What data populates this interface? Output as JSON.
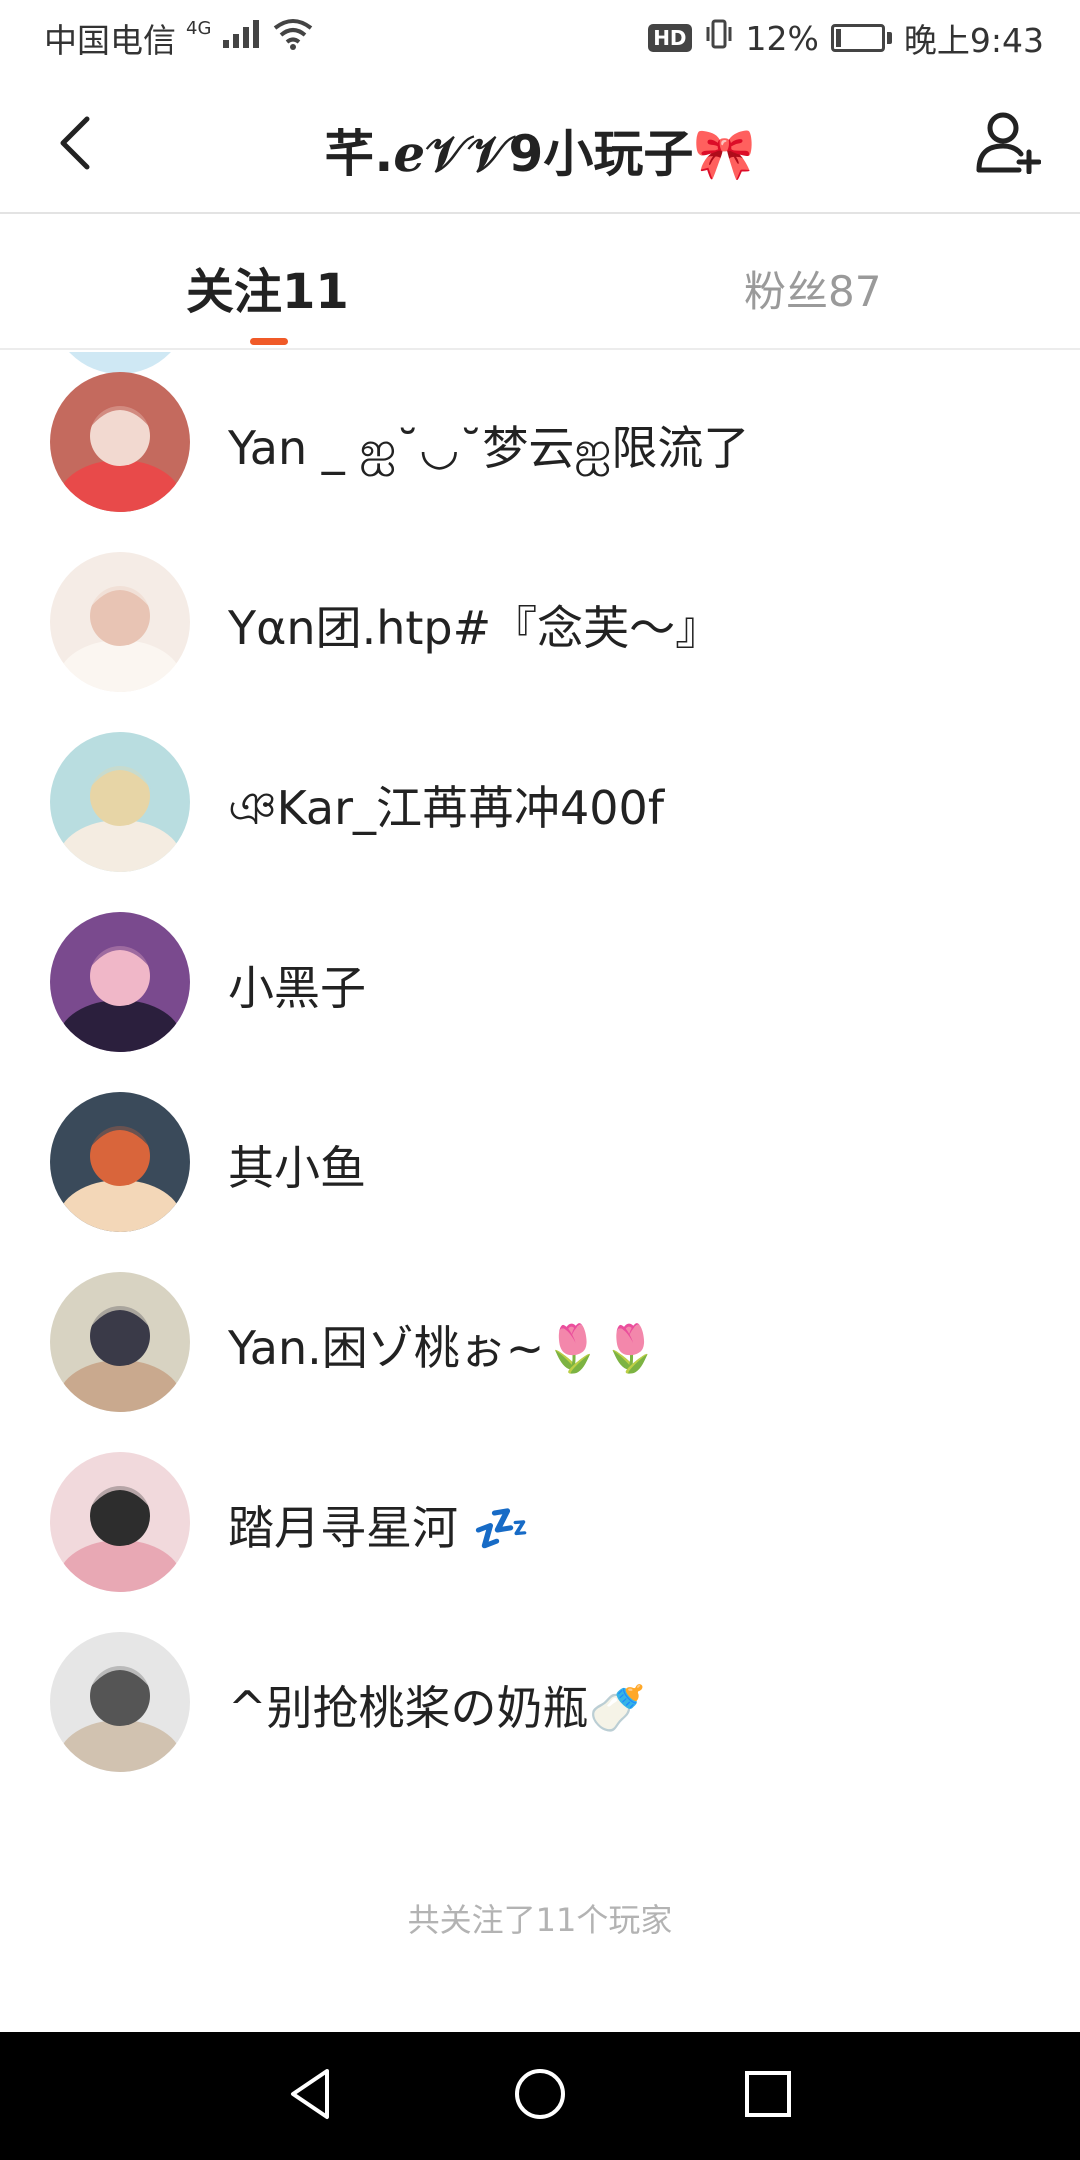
{
  "status_bar": {
    "carrier": "中国电信",
    "network": "4G",
    "hd_badge": "HD",
    "battery": "12%",
    "battery_level": 0.12,
    "time": "晚上9:43"
  },
  "header": {
    "title": "芊.ℯ𝒱𝒱9小玩子🎀",
    "back_icon": "chevron-left-icon",
    "follow_icon": "add-user-icon"
  },
  "tabs": [
    {
      "label": "关注11",
      "active": true
    },
    {
      "label": "粉丝87",
      "active": false
    }
  ],
  "colors": {
    "accent": "#f05a28",
    "text": "#222222",
    "muted": "#9a9a9a"
  },
  "following": [
    {
      "name": "Yan _ ஐ˘◡˘梦云ஐ限流了",
      "avatar_colors": [
        "#c46a5e",
        "#f2d9d0",
        "#e84a4a"
      ]
    },
    {
      "name": "Yαn团.htp#『念芙～』",
      "avatar_colors": [
        "#f5ece6",
        "#e8c4b4",
        "#fbf6f1"
      ]
    },
    {
      "name": "ঞKar_江苒苒冲400f",
      "avatar_colors": [
        "#b9dde0",
        "#e7d5a6",
        "#f4ece1"
      ]
    },
    {
      "name": "小黑子",
      "avatar_colors": [
        "#7a4a8e",
        "#f0b7c8",
        "#2b1f3d"
      ]
    },
    {
      "name": "其小鱼",
      "avatar_colors": [
        "#3a4a5a",
        "#d9653b",
        "#f3d7b8"
      ]
    },
    {
      "name": "Yan.困ゾ桃ぉ~🌷🌷",
      "avatar_colors": [
        "#d8d3c2",
        "#3a3a48",
        "#c9a98e"
      ]
    },
    {
      "name": "踏月寻星河 💤",
      "avatar_colors": [
        "#f1d9dc",
        "#2d2d2d",
        "#e8a8b4"
      ]
    },
    {
      "name": "^别抢桃桨の奶瓶🍼",
      "avatar_colors": [
        "#e6e6e6",
        "#555555",
        "#d1c2b0"
      ]
    }
  ],
  "footer": "共关注了11个玩家",
  "nav": {
    "back_icon": "triangle-back-icon",
    "home_icon": "circle-home-icon",
    "recents_icon": "square-recents-icon"
  }
}
